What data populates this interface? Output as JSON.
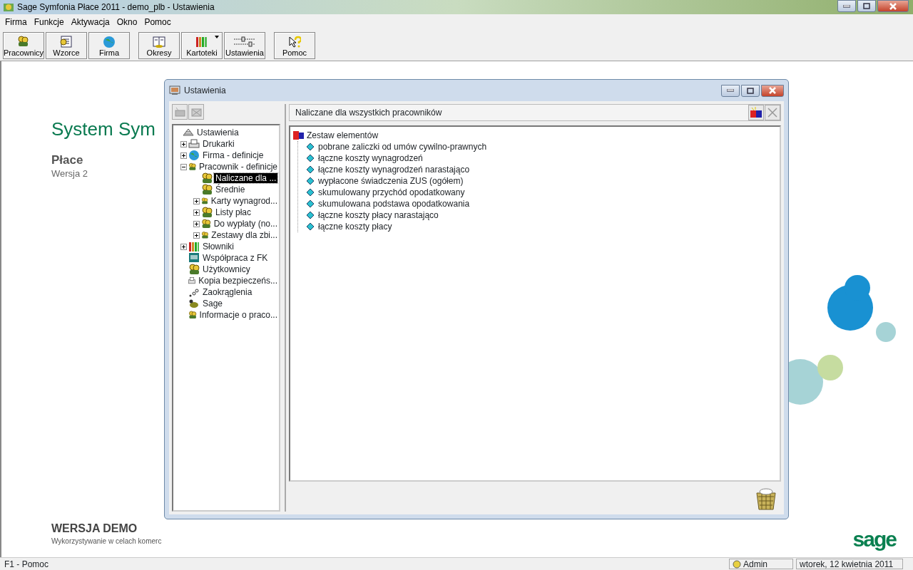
{
  "window": {
    "title": "Sage Symfonia Płace 2011 - demo_plb - Ustawienia"
  },
  "menu": [
    "Firma",
    "Funkcje",
    "Aktywacja",
    "Okno",
    "Pomoc"
  ],
  "toolbar": [
    {
      "label": "Pracownicy",
      "dropdown": false
    },
    {
      "label": "Wzorce",
      "dropdown": false
    },
    {
      "label": "Firma",
      "dropdown": false
    },
    {
      "label": "Okresy",
      "dropdown": false
    },
    {
      "label": "Kartoteki",
      "dropdown": true
    },
    {
      "label": "Ustawienia",
      "dropdown": false
    },
    {
      "label": "Pomoc",
      "dropdown": false
    }
  ],
  "background": {
    "heading": "System Sym",
    "product": "Płace",
    "version": "Wersja 2",
    "demo_title": "WERSJA DEMO",
    "demo_note": "Wykorzystywanie w celach komerc",
    "logo": "sage"
  },
  "dialog": {
    "title": "Ustawienia",
    "tree": {
      "label": "Ustawienia",
      "selected": false,
      "children": [
        {
          "label": "Drukarki",
          "expanded": false,
          "selected": false
        },
        {
          "label": "Firma - definicje",
          "expanded": false,
          "selected": false
        },
        {
          "label": "Pracownik - definicje",
          "expanded": true,
          "selected": false,
          "children": [
            {
              "label": "Naliczane dla ...",
              "selected": true
            },
            {
              "label": "Średnie",
              "selected": false
            },
            {
              "label": "Karty wynagrod...",
              "expanded": false,
              "selected": false
            },
            {
              "label": "Listy płac",
              "expanded": false,
              "selected": false
            },
            {
              "label": "Do wypłaty (no...",
              "expanded": false,
              "selected": false
            },
            {
              "label": "Zestawy dla zbi...",
              "expanded": false,
              "selected": false
            }
          ]
        },
        {
          "label": "Słowniki",
          "expanded": false,
          "selected": false
        },
        {
          "label": "Współpraca z FK",
          "selected": false
        },
        {
          "label": "Użytkownicy",
          "selected": false
        },
        {
          "label": "Kopia bezpieczeńs...",
          "selected": false
        },
        {
          "label": "Zaokrąglenia",
          "selected": false
        },
        {
          "label": "Sage",
          "selected": false
        },
        {
          "label": "Informacje o praco...",
          "selected": false
        }
      ]
    },
    "panel_title": "Naliczane dla wszystkich pracowników",
    "elements": {
      "label": "Zestaw elementów",
      "children": [
        {
          "label": "pobrane zaliczki od umów cywilno-prawnych"
        },
        {
          "label": "łączne koszty wynagrodzeń"
        },
        {
          "label": "łączne koszty wynagrodzeń narastająco"
        },
        {
          "label": "wypłacone świadczenia ZUS (ogółem)"
        },
        {
          "label": "skumulowany przychód opodatkowany"
        },
        {
          "label": "skumulowana podstawa opodatkowania"
        },
        {
          "label": "łączne koszty płacy narastająco"
        },
        {
          "label": "łączne koszty płacy"
        }
      ]
    }
  },
  "status_bar": {
    "help": "F1 - Pomoc",
    "user": "Admin",
    "date": "wtorek, 12 kwietnia 2011"
  }
}
